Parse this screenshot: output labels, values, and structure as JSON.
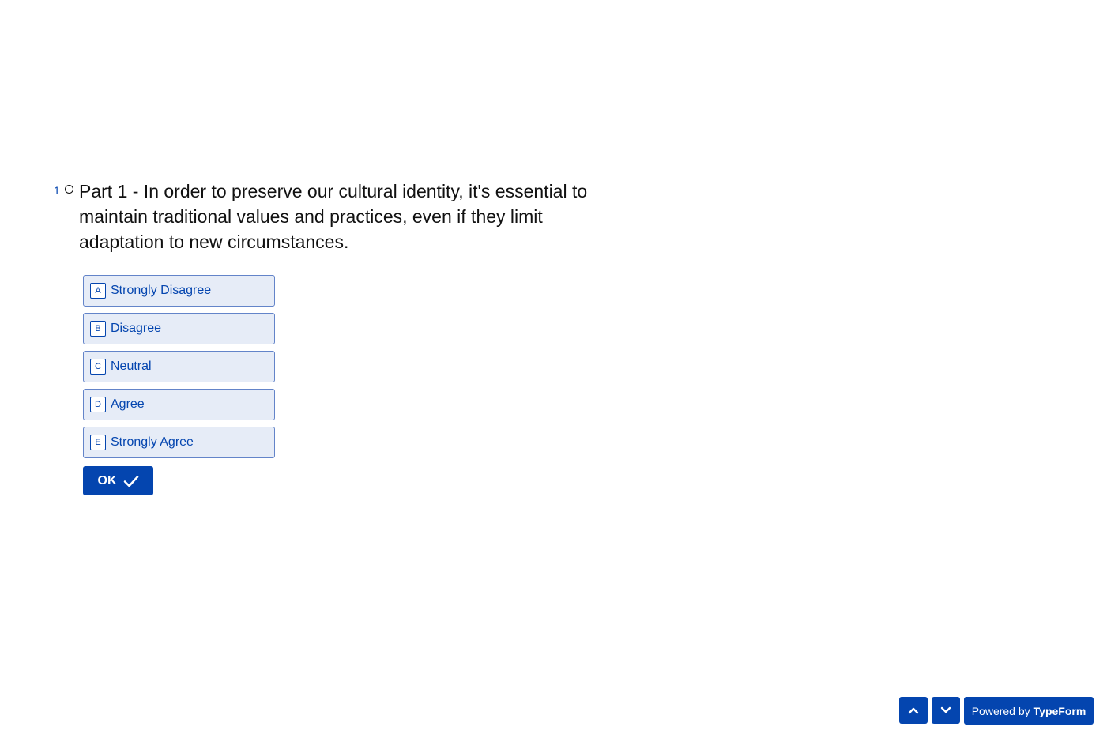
{
  "question": {
    "number": "1",
    "text": "Part 1 - In order to preserve our cultural identity, it's essential to maintain traditional values and practices, even if they limit adaptation to new circumstances."
  },
  "choices": [
    {
      "key": "A",
      "label": "Strongly Disagree"
    },
    {
      "key": "B",
      "label": "Disagree"
    },
    {
      "key": "C",
      "label": "Neutral"
    },
    {
      "key": "D",
      "label": "Agree"
    },
    {
      "key": "E",
      "label": "Strongly Agree"
    }
  ],
  "ok_button": {
    "label": "OK",
    "icon": "check-icon"
  },
  "footer": {
    "up_icon": "chevron-up-icon",
    "down_icon": "chevron-down-icon",
    "powered_prefix": "Powered by",
    "powered_brand": "TypeForm"
  },
  "colors": {
    "accent": "#0445AF",
    "choice_bg": "#e6ecf7",
    "choice_border": "#6384c9",
    "text": "#111111"
  }
}
